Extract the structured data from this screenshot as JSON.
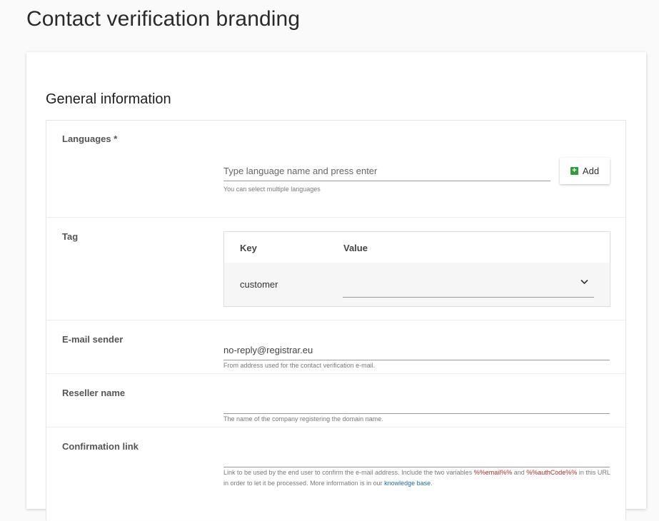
{
  "page": {
    "title": "Contact verification branding"
  },
  "section": {
    "title": "General information"
  },
  "languages": {
    "label": "Languages *",
    "placeholder": "Type language name and press enter",
    "hint": "You can select multiple languages",
    "add_label": "Add"
  },
  "tag": {
    "label": "Tag",
    "columns": {
      "key": "Key",
      "value": "Value"
    },
    "rows": [
      {
        "key": "customer",
        "value": ""
      }
    ]
  },
  "email_sender": {
    "label": "E-mail sender",
    "value": "no-reply@registrar.eu",
    "hint": "From address used for the contact verification e-mail."
  },
  "reseller_name": {
    "label": "Reseller name",
    "value": "",
    "hint": "The name of the company registering the domain name."
  },
  "confirmation_link": {
    "label": "Confirmation link",
    "value": "",
    "hint_part1": "Link to be used by the end user to confirm the e-mail address. Include the two variables ",
    "var_email": "%%email%%",
    "hint_and": " and ",
    "var_auth": "%%authCode%%",
    "hint_part2": " in this URL in order to let it be processed. More information is in our ",
    "link_text": "knowledge base",
    "hint_end": "."
  },
  "colors": {
    "accent_green": "#2e9e3c",
    "link_blue": "#1b6ea8",
    "variable_red": "#b02a2a"
  },
  "icons": {
    "add": "plus-square-icon",
    "dropdown": "chevron-down-icon"
  }
}
